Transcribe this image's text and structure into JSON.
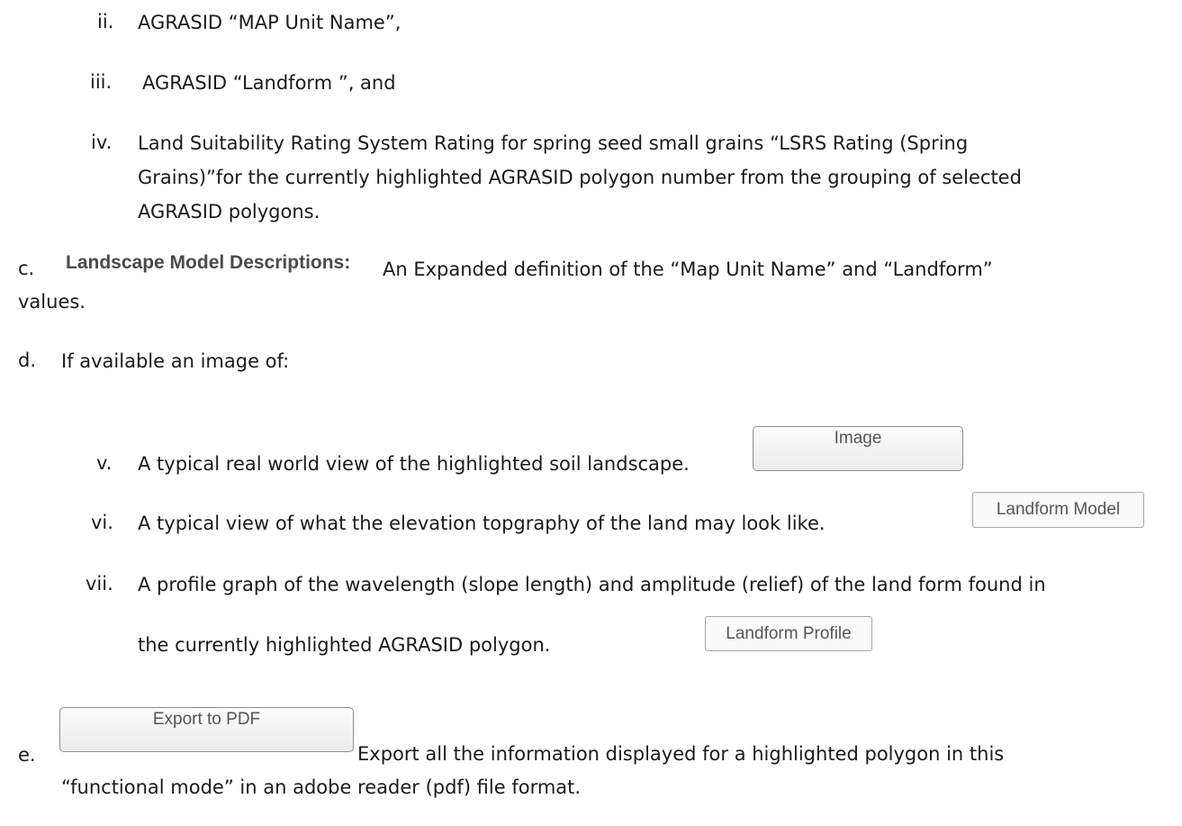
{
  "items": {
    "ii": {
      "marker": "ii.",
      "text": "AGRASID “MAP Unit Name”,"
    },
    "iii": {
      "marker": "iii.",
      "text": "AGRASID “Landform ”, and"
    },
    "iv": {
      "marker": "iv.",
      "line1": "Land Suitability Rating System Rating for spring seed small grains “LSRS Rating (Spring",
      "line2": "Grains)”for the currently highlighted AGRASID polygon number from the grouping of selected",
      "line3": "AGRASID polygons."
    },
    "c": {
      "marker": "c.",
      "label": "Landscape Model Descriptions:",
      "line1": "An Expanded definition of the “Map Unit Name” and “Landform”",
      "line2": "values."
    },
    "d": {
      "marker": "d.",
      "text": "If available an image of:"
    },
    "v": {
      "marker": "v.",
      "text": "A typical real world view of the highlighted soil landscape.",
      "button": "Image"
    },
    "vi": {
      "marker": "vi.",
      "text": "A typical view of what the elevation topgraphy of the land may look like.",
      "button": "Landform Model"
    },
    "vii": {
      "marker": "vii.",
      "line1": "A profile graph of the wavelength (slope length) and amplitude (relief) of the land form found in",
      "line2": "the currently highlighted AGRASID polygon.",
      "button": "Landform Profile"
    },
    "e": {
      "marker": "e.",
      "button": "Export to PDF",
      "line1": "Export all the information displayed for a highlighted polygon in this",
      "line2": "“functional mode” in an adobe reader (pdf) file format."
    }
  }
}
